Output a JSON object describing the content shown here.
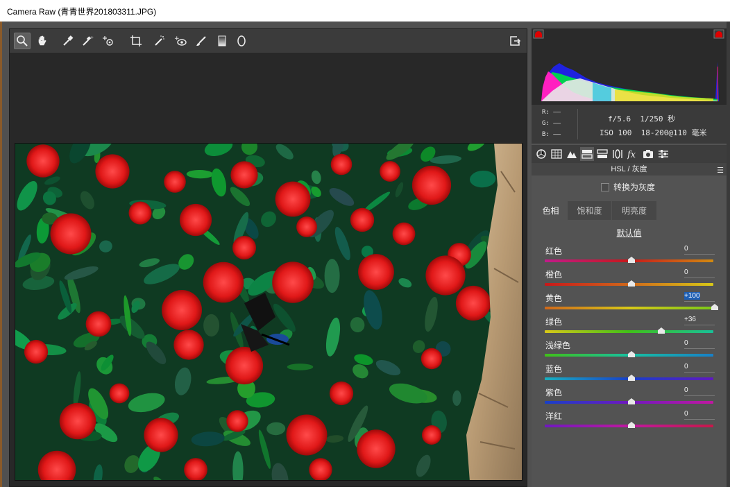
{
  "window": {
    "title": "Camera Raw (青青世界201803311.JPG)"
  },
  "toolbar": {
    "tools": [
      "zoom-icon",
      "hand-icon",
      "white-balance-icon",
      "color-sampler-icon",
      "target-adjustment-icon",
      "crop-icon",
      "spot-removal-icon",
      "red-eye-icon",
      "brush-icon",
      "graduated-filter-icon",
      "radial-filter-icon"
    ],
    "open_preferences_icon": "export-icon"
  },
  "info": {
    "r_label": "R:",
    "g_label": "G:",
    "b_label": "B:",
    "r_value": "——",
    "g_value": "——",
    "b_value": "——",
    "aperture": "f/5.6",
    "shutter": "1/250 秒",
    "iso": "ISO 100",
    "lens": "18-200@110 毫米"
  },
  "section": {
    "title": "HSL / 灰度",
    "convert_gray": "转换为灰度"
  },
  "hsl_tabs": [
    "色相",
    "饱和度",
    "明亮度"
  ],
  "default_link": "默认值",
  "sliders": [
    {
      "label": "红色",
      "value": "0",
      "fraction": 0.5
    },
    {
      "label": "橙色",
      "value": "0",
      "fraction": 0.5
    },
    {
      "label": "黄色",
      "value": "+100",
      "fraction": 1.0,
      "highlighted": true
    },
    {
      "label": "绿色",
      "value": "+36",
      "fraction": 0.68
    },
    {
      "label": "浅绿色",
      "value": "0",
      "fraction": 0.5
    },
    {
      "label": "蓝色",
      "value": "0",
      "fraction": 0.5
    },
    {
      "label": "紫色",
      "value": "0",
      "fraction": 0.5
    },
    {
      "label": "洋红",
      "value": "0",
      "fraction": 0.5
    }
  ],
  "colors": {
    "panel_bg": "#535353",
    "highlight": "#1e5fb4",
    "clip_warning": "#e00000"
  }
}
